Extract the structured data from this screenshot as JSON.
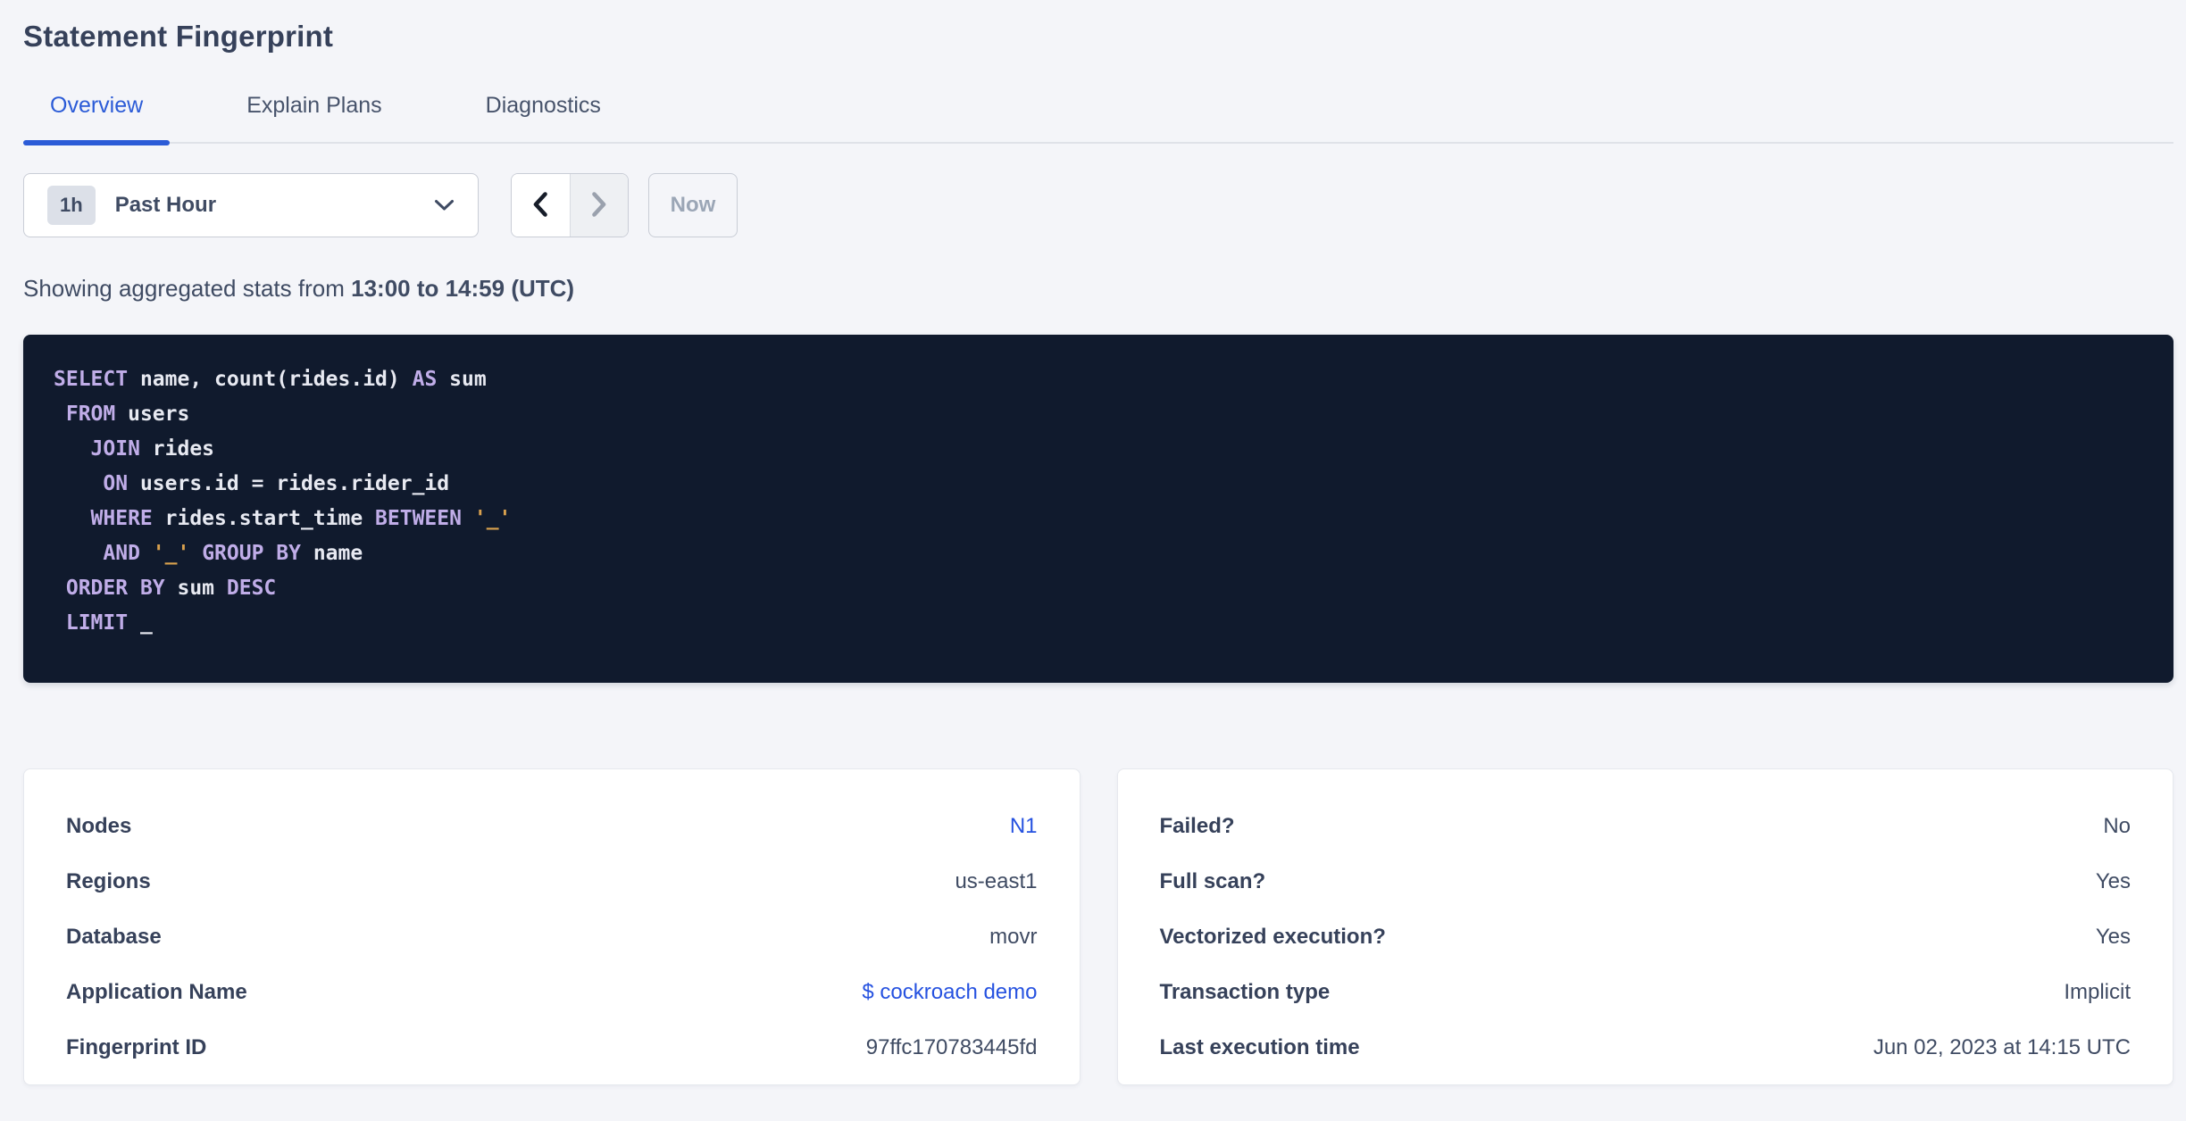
{
  "page": {
    "title": "Statement Fingerprint"
  },
  "tabs": [
    {
      "label": "Overview",
      "active": true
    },
    {
      "label": "Explain Plans",
      "active": false
    },
    {
      "label": "Diagnostics",
      "active": false
    }
  ],
  "time_controls": {
    "interval_badge": "1h",
    "interval_label": "Past Hour",
    "caret_icon": "chevron-down",
    "prev_icon": "chevron-left",
    "next_icon": "chevron-right",
    "now_label": "Now"
  },
  "caption": {
    "prefix": "Showing aggregated stats from ",
    "range_bold": "13:00 to 14:59 (UTC)"
  },
  "sql": {
    "lines": [
      [
        {
          "t": "kw",
          "v": "SELECT"
        },
        {
          "t": "pl",
          "v": " name, count(rides.id) "
        },
        {
          "t": "kw",
          "v": "AS"
        },
        {
          "t": "pl",
          "v": " sum"
        }
      ],
      [
        {
          "t": "pl",
          "v": " "
        },
        {
          "t": "kw",
          "v": "FROM"
        },
        {
          "t": "pl",
          "v": " users"
        }
      ],
      [
        {
          "t": "pl",
          "v": "   "
        },
        {
          "t": "kw",
          "v": "JOIN"
        },
        {
          "t": "pl",
          "v": " rides"
        }
      ],
      [
        {
          "t": "pl",
          "v": "    "
        },
        {
          "t": "kw",
          "v": "ON"
        },
        {
          "t": "pl",
          "v": " users.id = rides.rider_id"
        }
      ],
      [
        {
          "t": "pl",
          "v": "   "
        },
        {
          "t": "kw",
          "v": "WHERE"
        },
        {
          "t": "pl",
          "v": " rides.start_time "
        },
        {
          "t": "kw",
          "v": "BETWEEN"
        },
        {
          "t": "pl",
          "v": " "
        },
        {
          "t": "str",
          "v": "'_'"
        }
      ],
      [
        {
          "t": "pl",
          "v": "    "
        },
        {
          "t": "kw",
          "v": "AND"
        },
        {
          "t": "pl",
          "v": " "
        },
        {
          "t": "str",
          "v": "'_'"
        },
        {
          "t": "pl",
          "v": " "
        },
        {
          "t": "kw",
          "v": "GROUP BY"
        },
        {
          "t": "pl",
          "v": " name"
        }
      ],
      [
        {
          "t": "pl",
          "v": " "
        },
        {
          "t": "kw",
          "v": "ORDER BY"
        },
        {
          "t": "pl",
          "v": " sum "
        },
        {
          "t": "kw",
          "v": "DESC"
        }
      ],
      [
        {
          "t": "pl",
          "v": " "
        },
        {
          "t": "kw",
          "v": "LIMIT"
        },
        {
          "t": "pl",
          "v": " _"
        }
      ]
    ]
  },
  "details_card": {
    "rows": [
      {
        "label": "Nodes",
        "value": "N1",
        "link": true
      },
      {
        "label": "Regions",
        "value": "us-east1",
        "link": false
      },
      {
        "label": "Database",
        "value": "movr",
        "link": false
      },
      {
        "label": "Application Name",
        "value": "$ cockroach demo",
        "link": true
      },
      {
        "label": "Fingerprint ID",
        "value": "97ffc170783445fd",
        "link": false
      }
    ]
  },
  "attributes_card": {
    "rows": [
      {
        "label": "Failed?",
        "value": "No",
        "link": false
      },
      {
        "label": "Full scan?",
        "value": "Yes",
        "link": false
      },
      {
        "label": "Vectorized execution?",
        "value": "Yes",
        "link": false
      },
      {
        "label": "Transaction type",
        "value": "Implicit",
        "link": false
      },
      {
        "label": "Last execution time",
        "value": "Jun 02, 2023 at 14:15 UTC",
        "link": false
      }
    ]
  },
  "colors": {
    "accent": "#2b5bd7",
    "link": "#2652e0",
    "page_bg": "#f4f5f9",
    "text": "#3f4b63",
    "heading": "#36415a",
    "sql_bg": "#101a2d",
    "sql_keyword": "#c0ade8",
    "sql_plain": "#e7e9f1",
    "sql_string": "#d9a14e"
  }
}
